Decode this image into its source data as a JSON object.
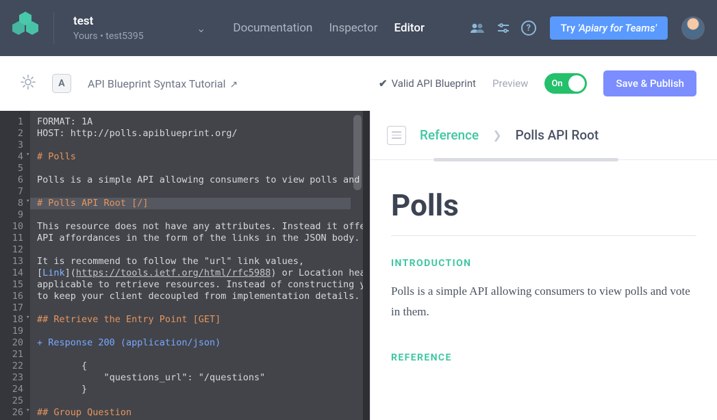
{
  "header": {
    "project_title": "test",
    "project_sub": "Yours • test5395",
    "nav": {
      "doc": "Documentation",
      "inspector": "Inspector",
      "editor": "Editor"
    },
    "try_label_prefix": "Try ",
    "try_label_em": "'Apiary for Teams'"
  },
  "subbar": {
    "tutorial_label": "API Blueprint Syntax Tutorial",
    "valid_label": "Valid API Blueprint",
    "preview_label": "Preview",
    "toggle_label": "On",
    "publish_label": "Save & Publish"
  },
  "editor": {
    "line_count": 26,
    "lines": [
      "FORMAT: 1A",
      "HOST: http://polls.apiblueprint.org/",
      "",
      "# Polls",
      "",
      "Polls is a simple API allowing consumers to view polls and ",
      "",
      "# Polls API Root [/]",
      "",
      "This resource does not have any attributes. Instead it offe",
      "API affordances in the form of the links in the JSON body.",
      "",
      "It is recommend to follow the \"url\" link values,",
      "[Link](https://tools.ietf.org/html/rfc5988) or Location hea",
      "applicable to retrieve resources. Instead of constructing y",
      "to keep your client decoupled from implementation details.",
      "",
      "## Retrieve the Entry Point [GET]",
      "",
      "+ Response 200 (application/json)",
      "",
      "        {",
      "            \"questions_url\": \"/questions\"",
      "        }",
      "",
      "## Group Question"
    ]
  },
  "preview": {
    "crumb_ref": "Reference",
    "crumb_title": "Polls API Root",
    "h1": "Polls",
    "intro_label": "INTRODUCTION",
    "intro_text": "Polls is a simple API allowing consumers to view polls and vote in them.",
    "ref_label": "REFERENCE"
  }
}
